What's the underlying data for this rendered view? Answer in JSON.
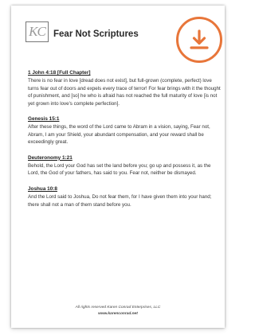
{
  "header": {
    "logo_text": "KC",
    "title": "Fear Not Scriptures"
  },
  "download": {
    "icon": "download-icon",
    "color": "#e8763a"
  },
  "scriptures": [
    {
      "reference": "1 John 4:18 [Full Chapter]",
      "text": "There is no fear in love [dread does not exist], but full-grown (complete, perfect) love turns fear out of doors and expels every trace of terror! For fear brings with it the thought of punishment, and [so] he who is afraid has not reached the full maturity of love [is not yet grown into love's complete perfection]."
    },
    {
      "reference": "Genesis 15:1",
      "text": "After these things, the word of the Lord came to Abram in a vision, saying, Fear not, Abram, I am your Shield, your abundant compensation, and your reward shall be exceedingly great."
    },
    {
      "reference": "Deuteronomy 1:21",
      "text": "Behold, the Lord your God has set the land before you; go up and possess it, as the Lord, the God of your fathers, has said to you. Fear not, neither be dismayed."
    },
    {
      "reference": "Joshua 10:8",
      "text": "And the Lord said to Joshua, Do not fear them, for I have given them into your hand; there shall not a man of them stand before you."
    }
  ],
  "footer": {
    "rights": "All rights reserved Karen Conrad Enterprises, LLC",
    "url": "www.karenconrad.net"
  }
}
